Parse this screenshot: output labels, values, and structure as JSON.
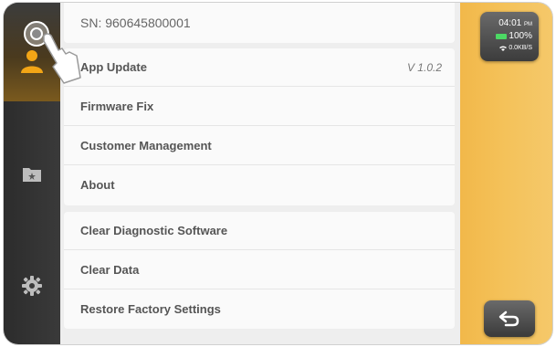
{
  "header": {
    "serial": "SN: 960645800001"
  },
  "settings": {
    "group1": [
      {
        "label": "App Update",
        "value": "V 1.0.2"
      },
      {
        "label": "Firmware Fix"
      },
      {
        "label": "Customer Management"
      },
      {
        "label": "About"
      }
    ],
    "group2": [
      {
        "label": "Clear Diagnostic Software"
      },
      {
        "label": "Clear Data"
      },
      {
        "label": "Restore Factory Settings"
      }
    ]
  },
  "status": {
    "time": "04:01",
    "ampm": "PM",
    "battery": "100%",
    "network": "0.0KB/S"
  },
  "sidebar": {
    "icons": [
      "user-icon",
      "folder-star-icon",
      "gear-icon"
    ]
  },
  "colors": {
    "accent": "#f4c25a",
    "sidebar": "#2c2c2c",
    "battery": "#4cd964"
  }
}
